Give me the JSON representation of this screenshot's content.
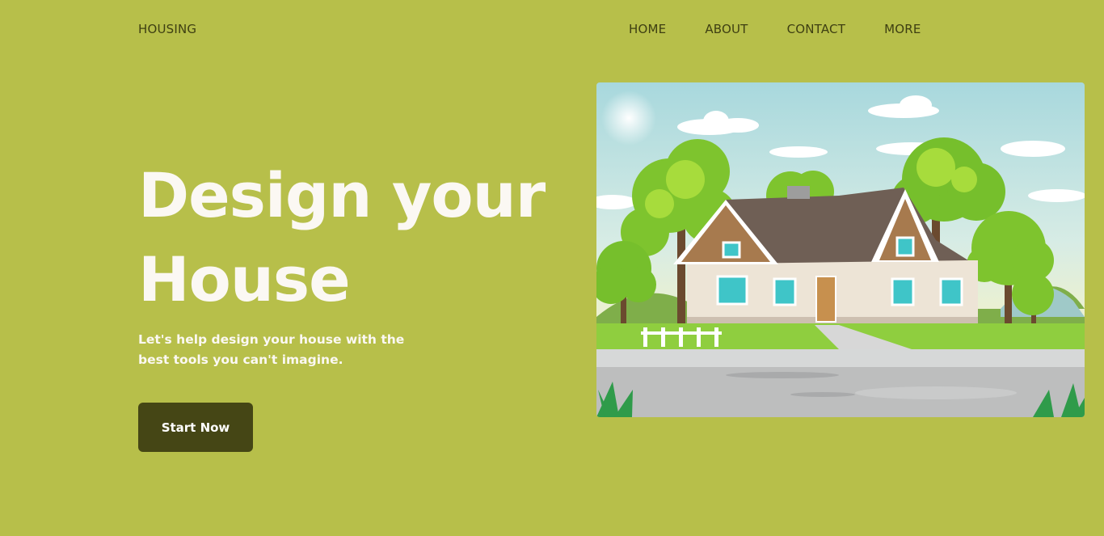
{
  "brand": {
    "logo": "HOUSING"
  },
  "nav": {
    "items": [
      "HOME",
      "ABOUT",
      "CONTACT",
      "MORE"
    ]
  },
  "hero": {
    "title_line1": "Design your",
    "title_line2": "House",
    "text": "Let's help design your house with the best tools you can't imagine.",
    "cta_label": "Start Now"
  },
  "colors": {
    "background": "#b7bf4a",
    "heading": "#fbf8f3",
    "button": "#454615",
    "nav_text": "#3e3f12"
  },
  "illustration": {
    "subject": "house-illustration"
  }
}
